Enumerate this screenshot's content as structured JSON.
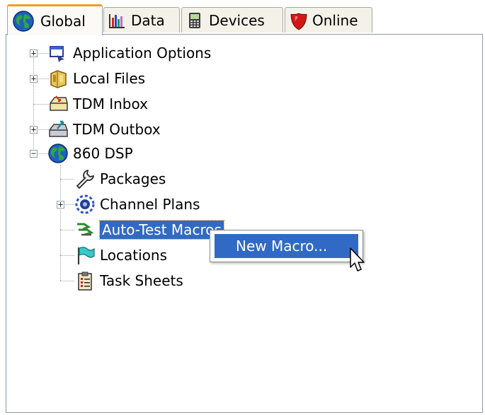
{
  "tabs": [
    {
      "label": "Global",
      "icon": "globe-icon",
      "active": true
    },
    {
      "label": "Data",
      "icon": "bar-chart-icon",
      "active": false
    },
    {
      "label": "Devices",
      "icon": "device-icon",
      "active": false
    },
    {
      "label": "Online",
      "icon": "shield-icon",
      "active": false
    }
  ],
  "tree": {
    "items": [
      {
        "label": "Application Options",
        "icon": "application-options-icon",
        "expander": "+"
      },
      {
        "label": "Local Files",
        "icon": "local-files-icon",
        "expander": "+"
      },
      {
        "label": "TDM Inbox",
        "icon": "tdm-inbox-icon",
        "expander": ""
      },
      {
        "label": "TDM Outbox",
        "icon": "tdm-outbox-icon",
        "expander": "+"
      },
      {
        "label": "860 DSP",
        "icon": "globe-icon",
        "expander": "−",
        "children": [
          {
            "label": "Packages",
            "icon": "wrench-icon",
            "expander": ""
          },
          {
            "label": "Channel Plans",
            "icon": "channel-plans-icon",
            "expander": "+"
          },
          {
            "label": "Auto-Test Macros",
            "icon": "auto-test-icon",
            "expander": "",
            "selected": true
          },
          {
            "label": "Locations",
            "icon": "flag-icon",
            "expander": ""
          },
          {
            "label": "Task Sheets",
            "icon": "clipboard-icon",
            "expander": ""
          }
        ]
      }
    ]
  },
  "context_menu": {
    "items": [
      {
        "label": "New Macro...",
        "highlighted": true
      }
    ]
  },
  "colors": {
    "selection": "#316ac5",
    "tab_accent": "#f0a020",
    "panel_border": "#8d99a4"
  }
}
